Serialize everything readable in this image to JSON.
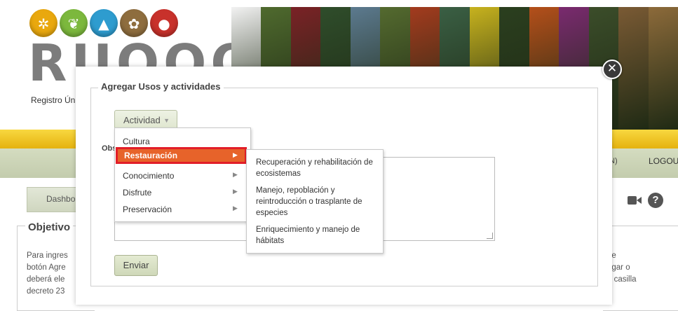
{
  "header": {
    "logo_word": "RUOOO",
    "logo_subtitle": "Registro Ún",
    "logo_icons": [
      {
        "name": "palm-tree-icon",
        "color": "#e9a80e",
        "glyph": "✲"
      },
      {
        "name": "leaf-icon",
        "color": "#7cb83d",
        "glyph": "❦"
      },
      {
        "name": "mountain-icon",
        "color": "#2e9ccf",
        "glyph": "▲"
      },
      {
        "name": "plant-icon",
        "color": "#8e6d3e",
        "glyph": "✿"
      },
      {
        "name": "bear-icon",
        "color": "#c8312b",
        "glyph": "●"
      }
    ],
    "photo_colors": [
      "#f2f2f2",
      "#4f6a2e",
      "#7a2226",
      "#2f4d2b",
      "#5c7a8f",
      "#546a2f",
      "#a33b1e",
      "#3a5f44",
      "#c7b21e",
      "#2b3f1f",
      "#b44f1a",
      "#7a2a6f",
      "#3b4d2a",
      "#7a5a34",
      "#8c6a3a"
    ]
  },
  "nav": {
    "partial_item": "N)",
    "logout": "LOGOUT",
    "tab_label": "Dashbo"
  },
  "objective": {
    "title": "Objetivo",
    "left_lines": [
      "Para ingres",
      "botón Agre",
      "deberá ele",
      "decreto 23"
    ],
    "right_lines": [
      "de",
      "egar o",
      "a casilla"
    ]
  },
  "modal": {
    "legend": "Agregar Usos y actividades",
    "activity_select": "Actividad",
    "obs_label": "Obs",
    "send_button": "Enviar",
    "close_symbol": "✕"
  },
  "menu": {
    "items": [
      {
        "label": "Cultura",
        "has_submenu": false
      },
      {
        "label": "Restauración",
        "has_submenu": true
      },
      {
        "label": "Conocimiento",
        "has_submenu": true
      },
      {
        "label": "Disfrute",
        "has_submenu": true
      },
      {
        "label": "Preservación",
        "has_submenu": true
      }
    ],
    "arrow": "▶"
  },
  "submenu": {
    "items": [
      "Recuperación y rehabilitación de ecosistemas",
      "Manejo, repoblación y reintroducción o trasplante de especies",
      "Enriquecimiento y manejo de hábitats"
    ]
  },
  "colors": {
    "menu_active_bg": "#e7632a",
    "menu_active_border": "#e21e28",
    "header_yellow": "#f2c42c",
    "nav_gray": "#cbd3b6"
  }
}
